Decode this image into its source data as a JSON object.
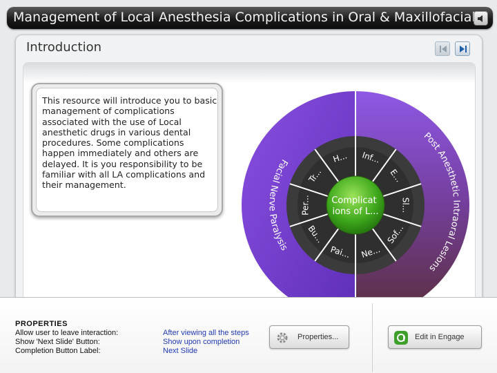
{
  "header": {
    "title": "Management of Local Anesthesia Complications in Oral & Maxillofacial Surgery"
  },
  "slide": {
    "title": "Introduction",
    "body": "This resource will introduce you to basic management of complications associated with the use of Local anesthetic drugs in various dental procedures. Some complications happen immediately and others are delayed. It is you responsibility to be familiar with all LA complications and their management."
  },
  "wheel": {
    "center_label_line1": "Complicat",
    "center_label_line2": "ions of L...",
    "outer_left_label": "Facial Nerve Paralysis",
    "outer_right_label": "Post Anesthetic Intraoral Lesions",
    "segments": [
      "Inf...",
      "E...",
      "Sl...",
      "Sof...",
      "Ne...",
      "Pai...",
      "Bu...",
      "Per...",
      "Tr...",
      "H..."
    ],
    "colors": {
      "outer_left": "#7a3fd3",
      "outer_right": "#6f3a78",
      "ring": "#3a3a3a",
      "center": "#3fa81c"
    }
  },
  "properties": {
    "heading": "PROPERTIES",
    "rows": [
      {
        "label": "Allow user to leave interaction:",
        "value": "After viewing all the steps"
      },
      {
        "label": "Show 'Next Slide' Button:",
        "value": "Show upon completion"
      },
      {
        "label": "Completion Button Label:",
        "value": "Next Slide"
      }
    ],
    "properties_button": "Properties...",
    "engage_button": "Edit in Engage"
  },
  "icons": {
    "audio": "speaker-icon",
    "prev": "prev-arrow-icon",
    "next": "next-arrow-icon",
    "gear": "gear-icon",
    "engage": "engage-logo-icon"
  }
}
